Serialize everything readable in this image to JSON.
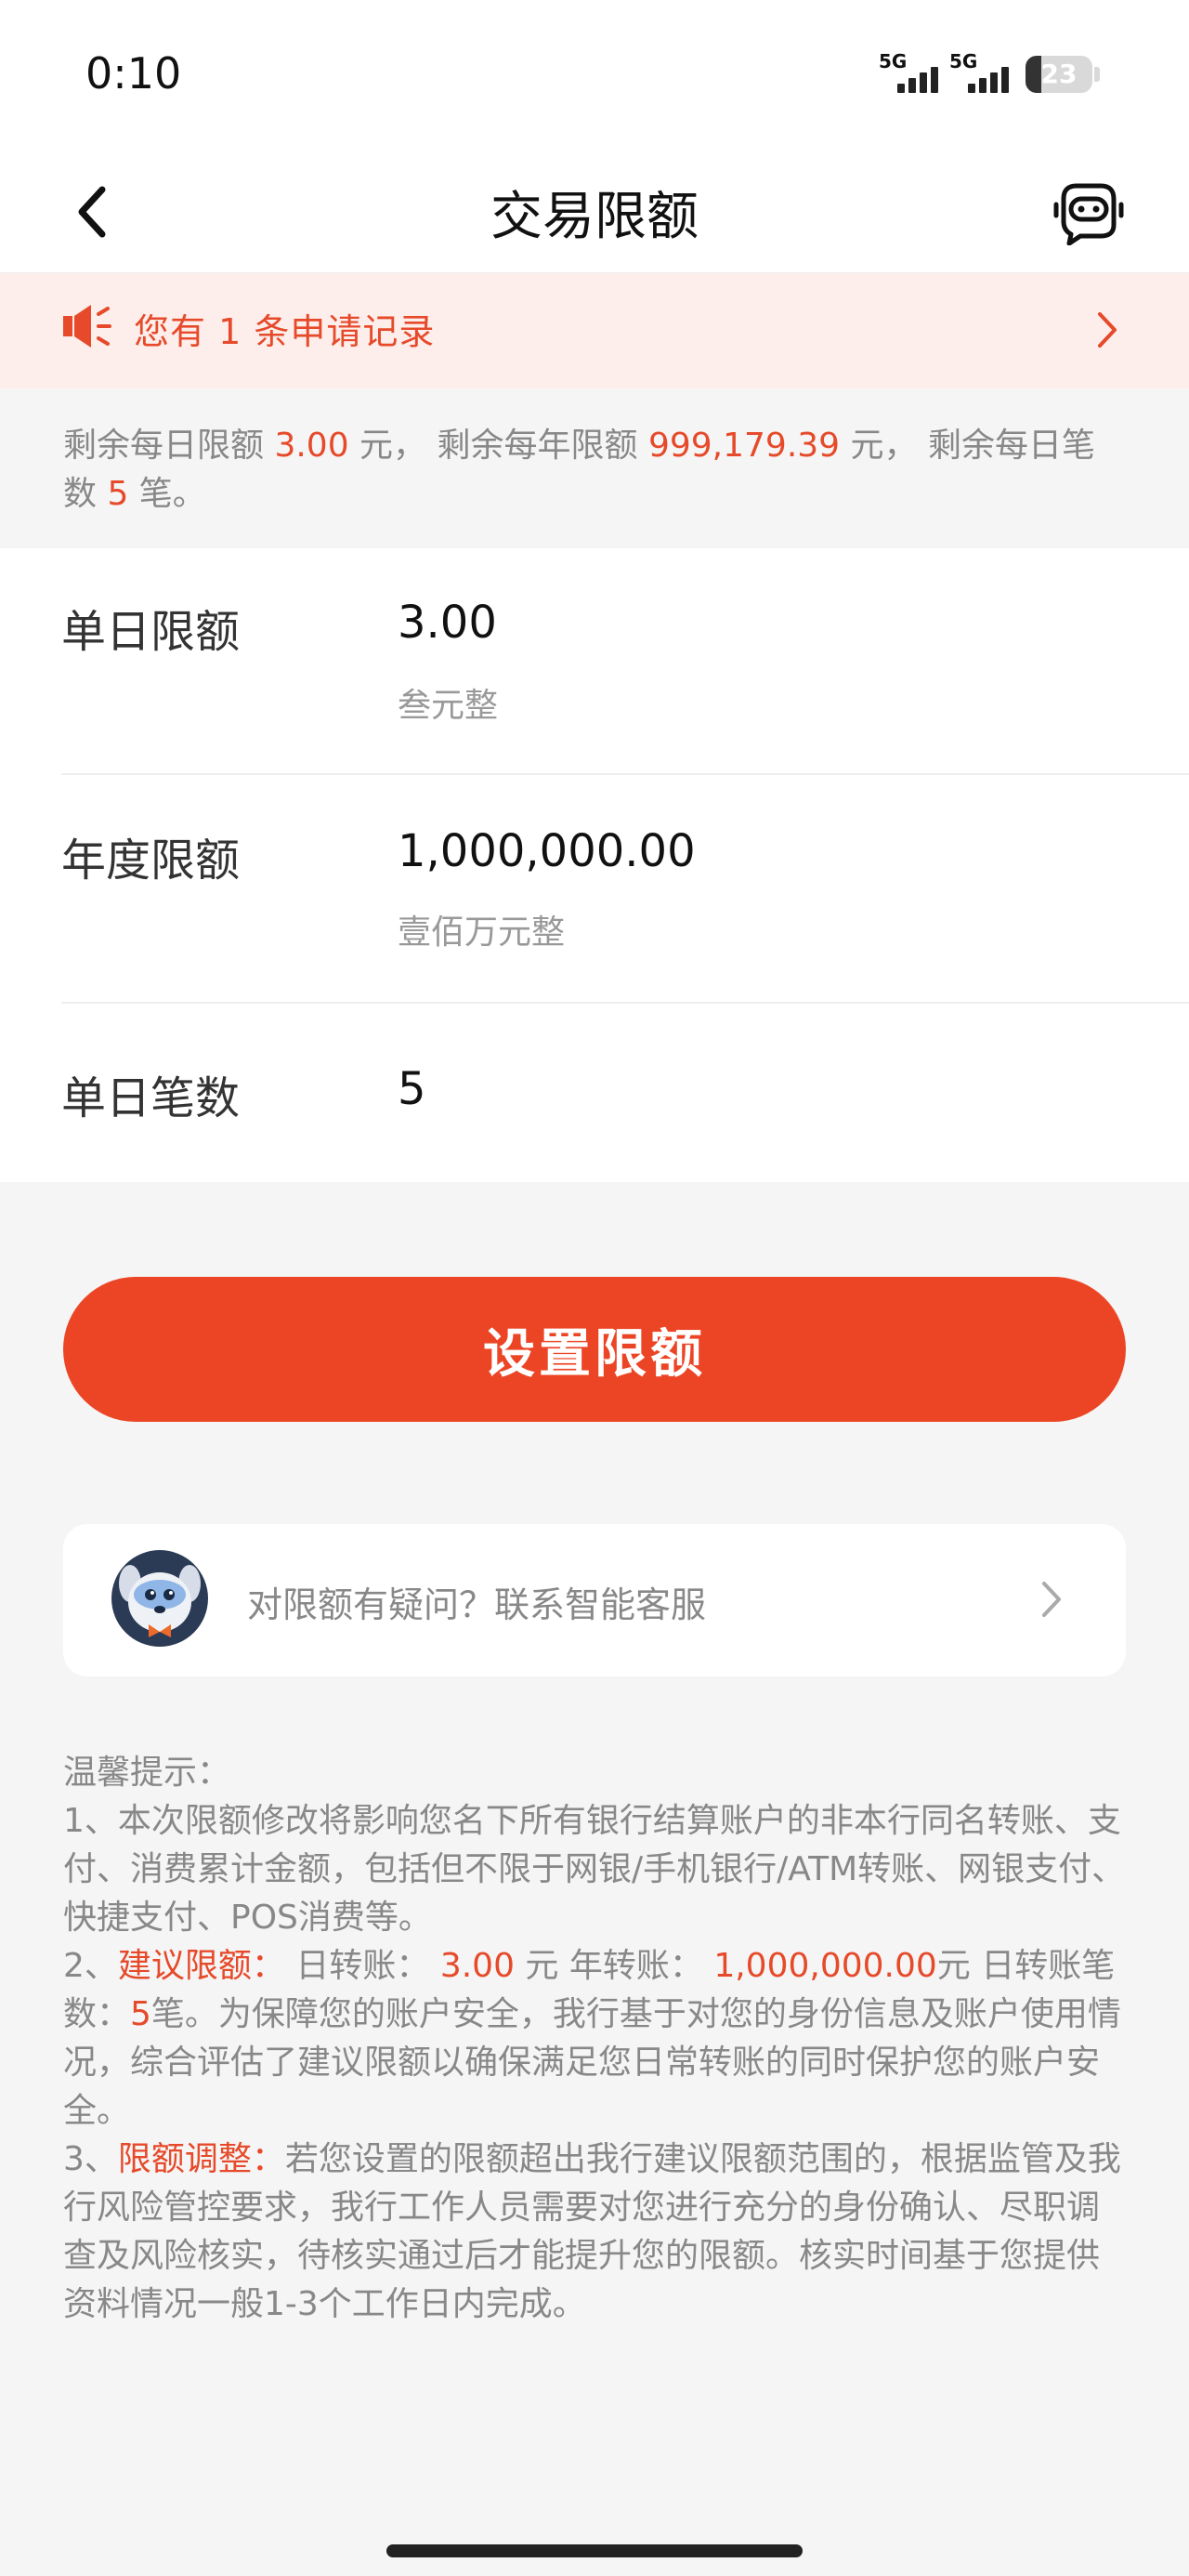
{
  "status_bar": {
    "time": "0:10",
    "network_1": "5G",
    "network_2": "5G",
    "battery": "23",
    "battery_level_percent": 23
  },
  "nav": {
    "title": "交易限额",
    "back_icon": "chevron-left-icon",
    "assistant_icon": "robot-icon"
  },
  "notice": {
    "icon": "speaker-icon",
    "prefix": "您有 ",
    "count": "1",
    "suffix": " 条申请记录"
  },
  "summary": {
    "daily_remaining_label": "剩余每日限额 ",
    "daily_remaining_value": "3.00",
    "daily_remaining_unit": " 元，  ",
    "yearly_remaining_label": "剩余每年限额 ",
    "yearly_remaining_value": "999,179.39",
    "yearly_remaining_unit": " 元，  ",
    "count_remaining_label": "剩余每日笔数 ",
    "count_remaining_value": "5",
    "count_remaining_unit": " 笔。"
  },
  "form": {
    "daily": {
      "label": "单日限额",
      "value": "3.00",
      "hint": "叁元整"
    },
    "yearly": {
      "label": "年度限额",
      "value": "1,000,000.00",
      "hint": "壹佰万元整"
    },
    "count": {
      "label": "单日笔数",
      "value": "5"
    }
  },
  "submit_label": "设置限额",
  "service": {
    "text": "对限额有疑问？联系智能客服",
    "avatar_icon": "robot-dog-avatar-icon"
  },
  "tips": {
    "title": "温馨提示：",
    "item1": "1、本次限额修改将影响您名下所有银行结算账户的非本行同名转账、支付、消费累计金额，包括但不限于网银/手机银行/ATM转账、网银支付、快捷支付、POS消费等。",
    "item2_prefix": "2、",
    "item2_highlight": "建议限额：",
    "item2_a": " 日转账： ",
    "item2_daily": "3.00",
    "item2_b": " 元 年转账： ",
    "item2_yearly": "1,000,000.00",
    "item2_c": "元 日转账笔数：",
    "item2_count": "5",
    "item2_d": "笔。为保障您的账户安全，我行基于对您的身份信息及账户使用情况，综合评估了建议限额以确保满足您日常转账的同时保护您的账户安全。",
    "item3_prefix": "3、",
    "item3_highlight": "限额调整：",
    "item3_text": "若您设置的限额超出我行建议限额范围的，根据监管及我行风险管控要求，我行工作人员需要对您进行充分的身份确认、尽职调查及风险核实，待核实通过后才能提升您的限额。核实时间基于您提供资料情况一般1-3个工作日内完成。"
  },
  "colors": {
    "accent": "#ec4525",
    "highlight_text": "#e64a2a",
    "notice_bg": "#fdeeeb",
    "page_bg": "#f5f5f5"
  }
}
